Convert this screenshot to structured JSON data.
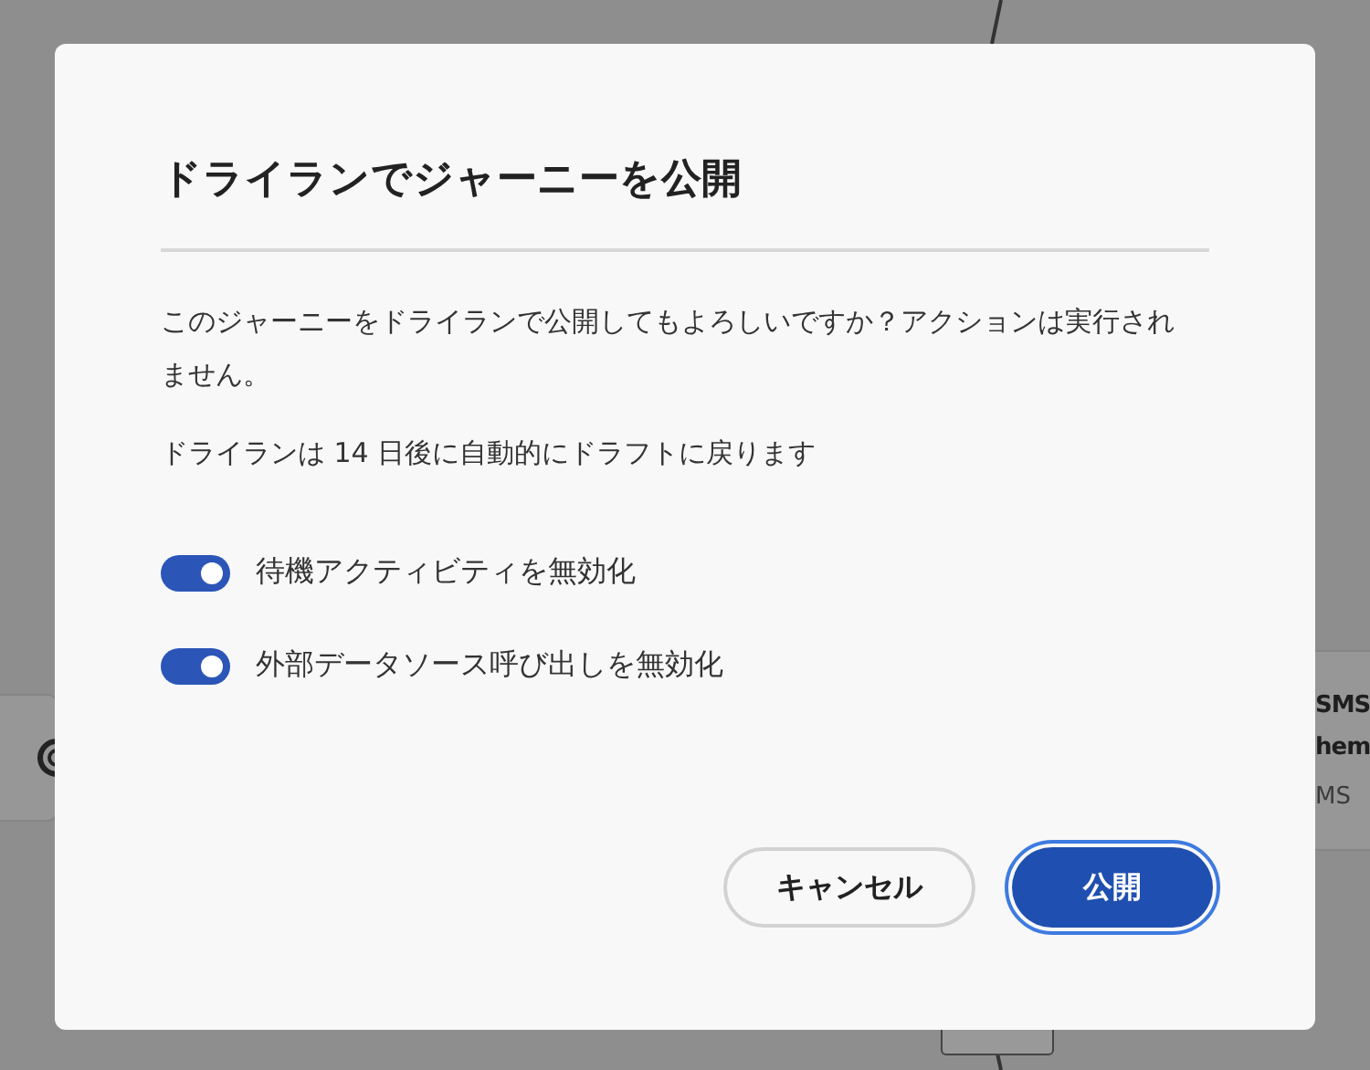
{
  "background": {
    "side_card": {
      "title_lines": [
        "SMS",
        "hem"
      ],
      "subtitle": "MS"
    }
  },
  "dialog": {
    "title": "ドライランでジャーニーを公開",
    "message": "このジャーニーをドライランで公開してもよろしいですか？アクションは実行されません。",
    "note": "ドライランは 14 日後に自動的にドラフトに戻ります",
    "toggles": [
      {
        "label": "待機アクティビティを無効化",
        "on": true
      },
      {
        "label": "外部データソース呼び出しを無効化",
        "on": true
      }
    ],
    "buttons": [
      {
        "label": "キャンセル",
        "kind": "secondary"
      },
      {
        "label": "公開",
        "kind": "primary"
      }
    ]
  }
}
